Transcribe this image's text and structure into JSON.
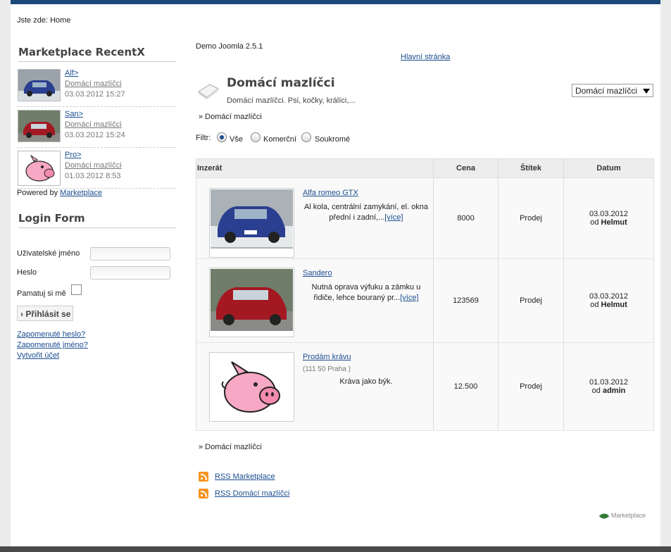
{
  "breadcrumb": {
    "label": "Jste zde:",
    "home": "Home"
  },
  "recent": {
    "title": "Marketplace RecentX",
    "items": [
      {
        "title": "Alf>",
        "category": "Domácí mazlíčci",
        "date": "03.03.2012 15:27"
      },
      {
        "title": "San>",
        "category": "Domácí mazlíčci",
        "date": "03.03.2012 15:24"
      },
      {
        "title": "Pro>",
        "category": "Domácí mazlíčci",
        "date": "01.03.2012 8:53"
      }
    ],
    "powered_prefix": "Powered by",
    "powered_link": "Marketplace"
  },
  "login": {
    "title": "Login Form",
    "username_label": "Uživatelské jméno",
    "password_label": "Heslo",
    "remember_label": "Pamatuj si mě",
    "submit_label": "Přihlásit se",
    "forgot_password": "Zapomenuté heslo?",
    "forgot_username": "Zapomenuté jméno?",
    "create_account": "Vytvořit účet"
  },
  "site_name": "Demo Joomla 2.5.1",
  "home_link": "Hlavní stránka",
  "category": {
    "title": "Domácí mazlíčci",
    "description": "Domácí mazlíčci. Psi, kočky, králíci,...",
    "select_value": "Domácí mazlíčci",
    "crumb": "» Domácí mazlíčci"
  },
  "filter": {
    "label": "Filtr:",
    "options": [
      "Vše",
      "Komerční",
      "Soukromé"
    ],
    "selected": "Vše"
  },
  "table": {
    "headers": [
      "Inzerát",
      "Cena",
      "Štítek",
      "Datum"
    ],
    "rows": [
      {
        "title": "Alfa romeo GTX",
        "location": "",
        "desc": "Al kola, centrální zamykání, el. okna přední i zadní,...",
        "more": "[více]",
        "price": "8000",
        "tag": "Prodej",
        "date": "03.03.2012",
        "by_prefix": "od",
        "author": "Helmut"
      },
      {
        "title": "Sandero",
        "location": "",
        "desc": "Nutná oprava výfuku a zámku u řidiče, lehce bouraný pr...",
        "more": "[více]",
        "price": "123569",
        "tag": "Prodej",
        "date": "03.03.2012",
        "by_prefix": "od",
        "author": "Helmut"
      },
      {
        "title": "Prodám krávu",
        "location": "(111 50 Praha )",
        "desc": "Kráva jako býk.",
        "more": "",
        "price": "12.500",
        "tag": "Prodej",
        "date": "01.03.2012",
        "by_prefix": "od",
        "author": "admin"
      }
    ]
  },
  "rss": {
    "marketplace": "RSS Marketplace",
    "category": "RSS Domácí mazlíčci"
  },
  "footer_brand": "Marketplace",
  "colors": {
    "topbar": "#1b4a7a",
    "link": "#1a4d8f",
    "rss": "#f7931e",
    "footerbar": "#4a4a4a"
  }
}
